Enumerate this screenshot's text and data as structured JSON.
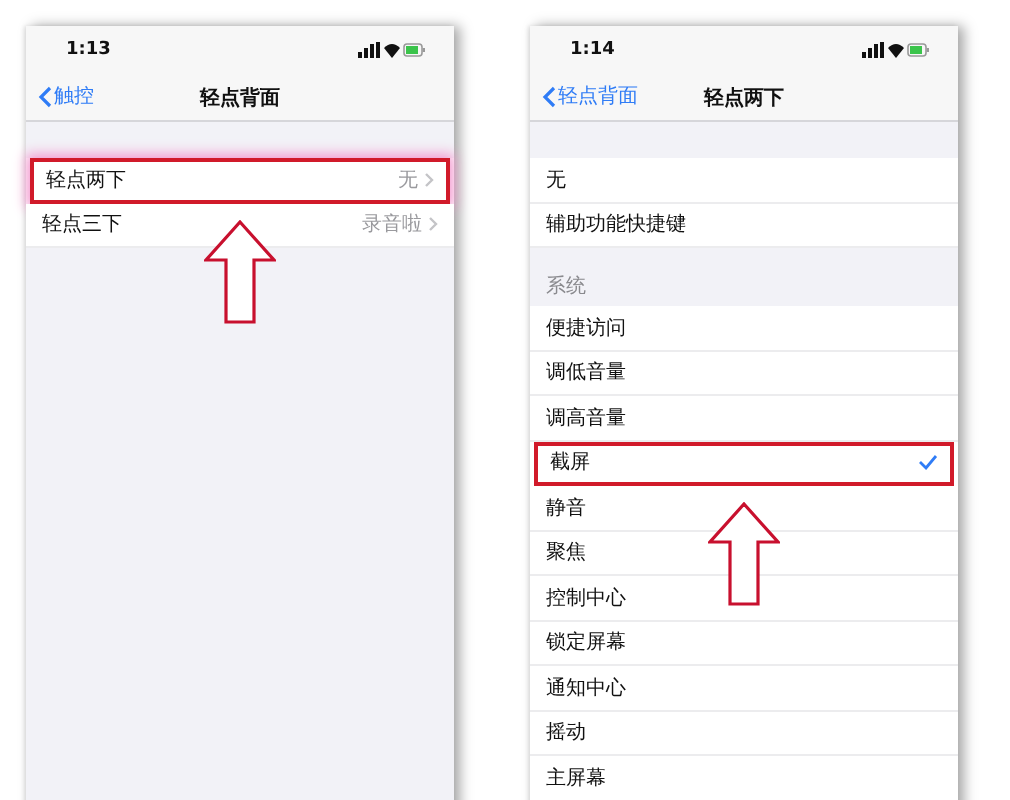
{
  "screens": [
    {
      "time": "1:13",
      "back": "触控",
      "title": "轻点背面",
      "groups": [
        {
          "rows": [
            {
              "kind": "link",
              "label": "轻点两下",
              "value": "无",
              "highlighted": true
            },
            {
              "kind": "link",
              "label": "轻点三下",
              "value": "录音啦",
              "highlighted": false
            }
          ]
        }
      ]
    },
    {
      "time": "1:14",
      "back": "轻点背面",
      "title": "轻点两下",
      "groups": [
        {
          "rows": [
            {
              "kind": "option",
              "label": "无",
              "checked": false,
              "highlighted": false
            },
            {
              "kind": "option",
              "label": "辅助功能快捷键",
              "checked": false,
              "highlighted": false
            }
          ]
        },
        {
          "header": "系统",
          "rows": [
            {
              "kind": "option",
              "label": "便捷访问",
              "checked": false,
              "highlighted": false
            },
            {
              "kind": "option",
              "label": "调低音量",
              "checked": false,
              "highlighted": false
            },
            {
              "kind": "option",
              "label": "调高音量",
              "checked": false,
              "highlighted": false
            },
            {
              "kind": "option",
              "label": "截屏",
              "checked": true,
              "highlighted": true
            },
            {
              "kind": "option",
              "label": "静音",
              "checked": false,
              "highlighted": false
            },
            {
              "kind": "option",
              "label": "聚焦",
              "checked": false,
              "highlighted": false
            },
            {
              "kind": "option",
              "label": "控制中心",
              "checked": false,
              "highlighted": false
            },
            {
              "kind": "option",
              "label": "锁定屏幕",
              "checked": false,
              "highlighted": false
            },
            {
              "kind": "option",
              "label": "通知中心",
              "checked": false,
              "highlighted": false
            },
            {
              "kind": "option",
              "label": "摇动",
              "checked": false,
              "highlighted": false
            },
            {
              "kind": "option",
              "label": "主屏幕",
              "checked": false,
              "highlighted": false
            }
          ]
        }
      ]
    }
  ]
}
